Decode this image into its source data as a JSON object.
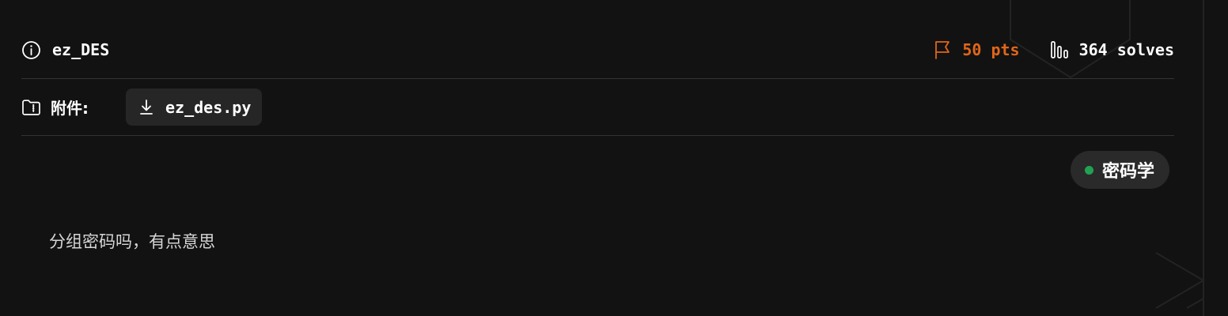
{
  "challenge": {
    "name": "ez_DES",
    "points_text": "50 pts",
    "solves_text": "364 solves",
    "points_color": "#e0661a"
  },
  "attachments": {
    "label": "附件:",
    "files": [
      {
        "name": "ez_des.py"
      }
    ]
  },
  "category": {
    "label": "密码学",
    "dot_color": "#22a152"
  },
  "description": "分组密码吗，有点意思",
  "icons": {
    "info": "info-circle-icon",
    "points": "flag-icon",
    "solves": "bar-chart-icon",
    "attachment": "folder-zip-icon",
    "download": "download-icon"
  }
}
